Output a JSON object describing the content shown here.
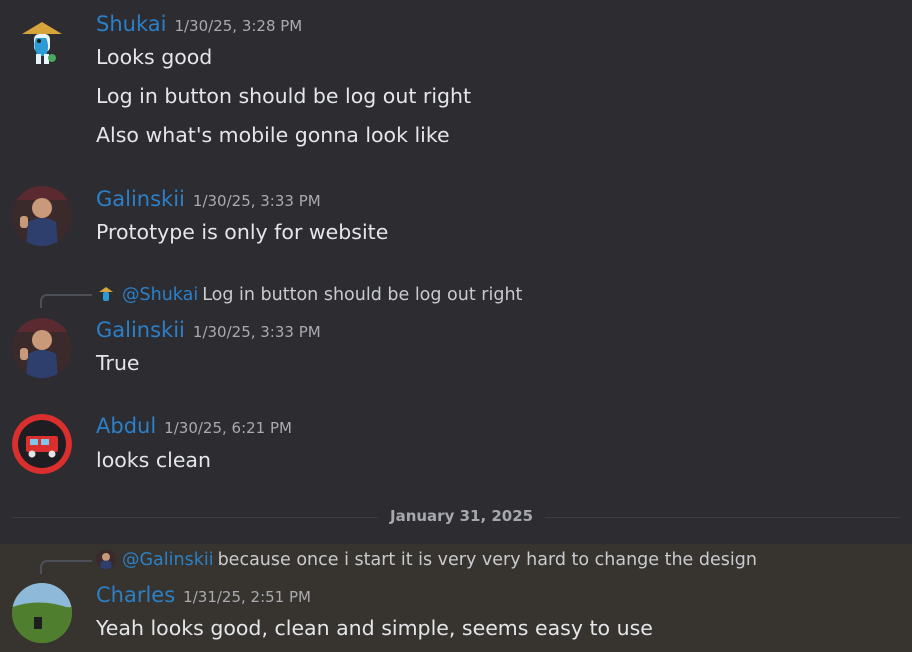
{
  "messages": [
    {
      "author": "Shukai",
      "timestamp": "1/30/25, 3:28 PM",
      "lines": [
        "Looks good",
        "Log in button should be log out right",
        "Also what's mobile gonna look like"
      ]
    },
    {
      "author": "Galinskii",
      "timestamp": "1/30/25, 3:33 PM",
      "lines": [
        "Prototype is only for website"
      ]
    },
    {
      "reply": {
        "mention": "@Shukai",
        "text": "Log in button should be log out right"
      },
      "author": "Galinskii",
      "timestamp": "1/30/25, 3:33 PM",
      "lines": [
        "True"
      ]
    },
    {
      "author": "Abdul",
      "timestamp": "1/30/25, 6:21 PM",
      "lines": [
        "looks clean"
      ]
    },
    {
      "reply": {
        "mention": "@Galinskii",
        "text": "because once i start it is very very hard to change the design"
      },
      "author": "Charles",
      "timestamp": "1/31/25, 2:51 PM",
      "lines": [
        "Yeah looks good, clean and simple, seems easy to use"
      ]
    }
  ],
  "date_divider": "January 31, 2025",
  "colors": {
    "background": "#2c2c31",
    "author_name": "#2b80c8",
    "highlight_background": "#37332f"
  }
}
